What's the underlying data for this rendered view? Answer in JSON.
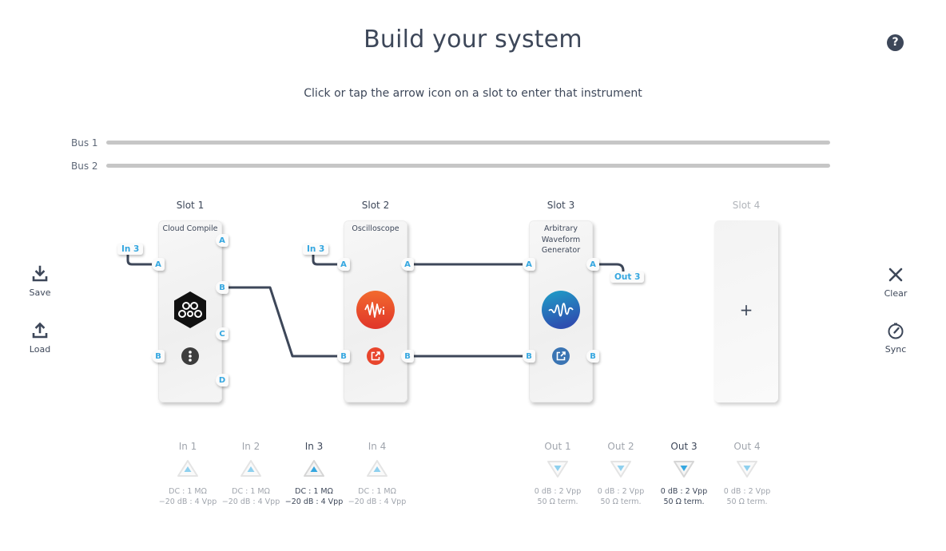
{
  "header": {
    "title": "Build your system",
    "subtitle": "Click or tap the arrow icon on a slot to enter that instrument",
    "help_icon": "question-circle-icon",
    "help_glyph": "?"
  },
  "buses": [
    {
      "label": "Bus 1"
    },
    {
      "label": "Bus 2"
    }
  ],
  "left_actions": [
    {
      "label": "Save",
      "icon": "download-icon"
    },
    {
      "label": "Load",
      "icon": "upload-icon"
    }
  ],
  "right_actions": [
    {
      "label": "Clear",
      "icon": "close-icon"
    },
    {
      "label": "Sync",
      "icon": "gauge-icon"
    }
  ],
  "slots": [
    {
      "label": "Slot 1",
      "instrument": "Cloud Compile",
      "icon": "cloud-compile-icon",
      "action_icon": "more-vertical-icon",
      "inputs": [
        "A",
        "B"
      ],
      "outputs": [
        "A",
        "B",
        "C",
        "D"
      ],
      "input_tag": "In 3"
    },
    {
      "label": "Slot 2",
      "instrument": "Oscilloscope",
      "icon": "oscilloscope-icon",
      "action_icon": "open-instrument-icon",
      "inputs": [
        "A",
        "B"
      ],
      "outputs": [
        "A",
        "B"
      ],
      "input_tag": "In 3"
    },
    {
      "label": "Slot 3",
      "instrument": "Arbitrary Waveform Generator",
      "instrument_lines": [
        "Arbitrary",
        "Waveform",
        "Generator"
      ],
      "icon": "waveform-generator-icon",
      "action_icon": "open-instrument-icon",
      "inputs": [
        "A",
        "B"
      ],
      "outputs": [
        "A",
        "B"
      ],
      "output_tag": "Out 3"
    },
    {
      "label": "Slot 4",
      "empty": true,
      "add_glyph": "+",
      "icon": "plus-icon"
    }
  ],
  "inputs": [
    {
      "name": "In 1",
      "line1": "DC : 1 MΩ",
      "line2": "−20 dB : 4 Vpp",
      "active": false
    },
    {
      "name": "In 2",
      "line1": "DC : 1 MΩ",
      "line2": "−20 dB : 4 Vpp",
      "active": false
    },
    {
      "name": "In 3",
      "line1": "DC : 1 MΩ",
      "line2": "−20 dB : 4 Vpp",
      "active": true
    },
    {
      "name": "In 4",
      "line1": "DC : 1 MΩ",
      "line2": "−20 dB : 4 Vpp",
      "active": false
    }
  ],
  "outputs": [
    {
      "name": "Out 1",
      "line1": "0 dB : 2 Vpp",
      "line2": "50 Ω term.",
      "active": false
    },
    {
      "name": "Out 2",
      "line1": "0 dB : 2 Vpp",
      "line2": "50 Ω term.",
      "active": false
    },
    {
      "name": "Out 3",
      "line1": "0 dB : 2 Vpp",
      "line2": "50 Ω term.",
      "active": true
    },
    {
      "name": "Out 4",
      "line1": "0 dB : 2 Vpp",
      "line2": "50 Ω term.",
      "active": false
    }
  ],
  "colors": {
    "text": "#3d4759",
    "port_accent": "#35a7e0",
    "oscilloscope": "#e8452c",
    "awg": "#2f6fb5",
    "wire": "#3d4759",
    "bus": "#c6c6c6"
  }
}
